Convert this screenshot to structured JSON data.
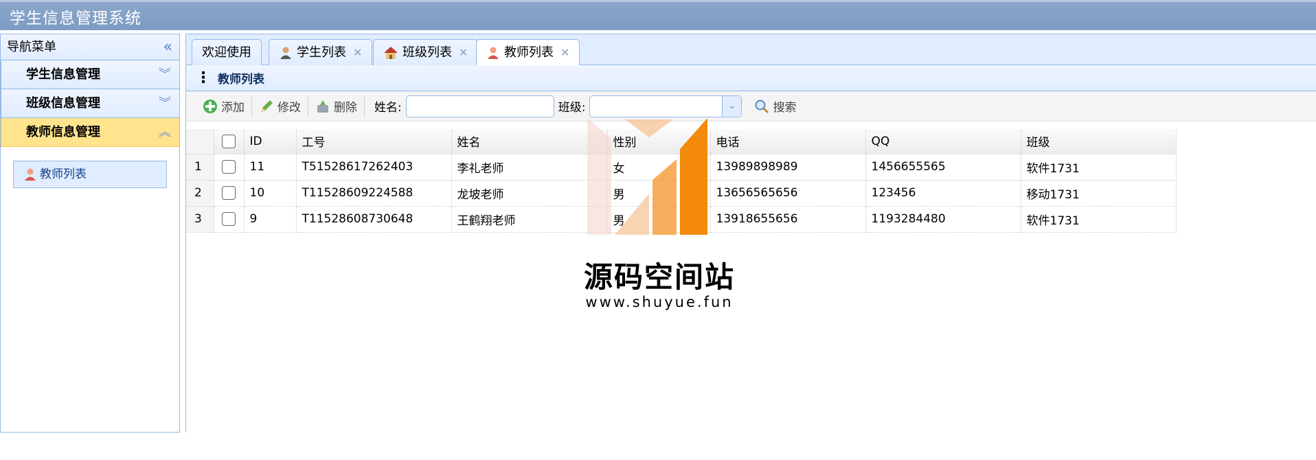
{
  "app": {
    "title": "学生信息管理系统"
  },
  "nav": {
    "header": "导航菜单",
    "sections": [
      {
        "label": "学生信息管理",
        "expanded": false
      },
      {
        "label": "班级信息管理",
        "expanded": false
      },
      {
        "label": "教师信息管理",
        "expanded": true
      }
    ],
    "active_link": "教师列表"
  },
  "tabs": [
    {
      "label": "欢迎使用",
      "closable": false
    },
    {
      "label": "学生列表",
      "closable": true
    },
    {
      "label": "班级列表",
      "closable": true
    },
    {
      "label": "教师列表",
      "closable": true,
      "active": true
    }
  ],
  "panel": {
    "title": "教师列表"
  },
  "toolbar": {
    "add_label": "添加",
    "edit_label": "修改",
    "delete_label": "删除",
    "name_label": "姓名:",
    "class_label": "班级:",
    "search_label": "搜索"
  },
  "grid": {
    "columns": [
      "",
      "",
      "ID",
      "工号",
      "姓名",
      "性别",
      "电话",
      "QQ",
      "班级"
    ],
    "rows": [
      {
        "num": "1",
        "id": "11",
        "sn": "T51528617262403",
        "name": "李礼老师",
        "gender": "女",
        "phone": "13989898989",
        "qq": "1456655565",
        "class": "软件1731"
      },
      {
        "num": "2",
        "id": "10",
        "sn": "T11528609224588",
        "name": "龙坡老师",
        "gender": "男",
        "phone": "13656565656",
        "qq": "123456",
        "class": "移动1731"
      },
      {
        "num": "3",
        "id": "9",
        "sn": "T11528608730648",
        "name": "王鹤翔老师",
        "gender": "男",
        "phone": "13918655656",
        "qq": "1193284480",
        "class": "软件1731"
      }
    ]
  },
  "watermark": {
    "text": "源码空间站",
    "url": "www.shuyue.fun"
  },
  "colors": {
    "border": "#95b8e7",
    "header_bg": "#e0ecff",
    "active": "#ffe48d",
    "titlebar": "#7e9bc2"
  }
}
